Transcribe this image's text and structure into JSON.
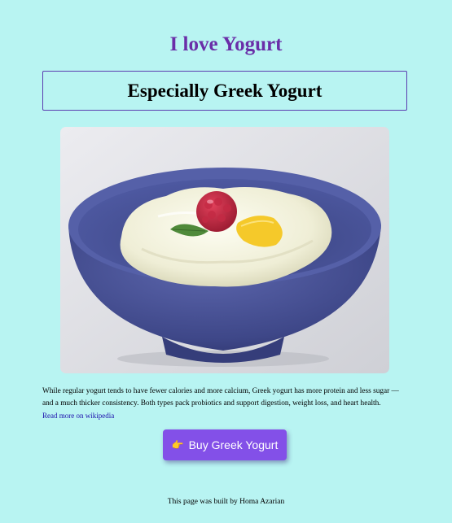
{
  "page": {
    "title": "I love Yogurt",
    "subtitle": "Especially Greek Yogurt"
  },
  "image": {
    "alt": "Bowl of Greek yogurt with raspberry, mint and lemon",
    "icon": "yogurt-bowl-image"
  },
  "description": {
    "text": "While regular yogurt tends to have fewer calories and more calcium, Greek yogurt has more protein and less sugar — and a much thicker consistency. Both types pack probiotics and support digestion, weight loss, and heart health.",
    "link_text": "Read more on wikipedia"
  },
  "buy_button": {
    "icon": "pointing-hand-icon",
    "label": "Buy Greek Yogurt"
  },
  "footer": {
    "text": "This page was built by Homa Azarian"
  },
  "colors": {
    "background": "#b8f4f2",
    "title": "#6a2ea8",
    "button": "#8350e8",
    "link": "#1a0dab",
    "bowl": "#4a5399"
  }
}
